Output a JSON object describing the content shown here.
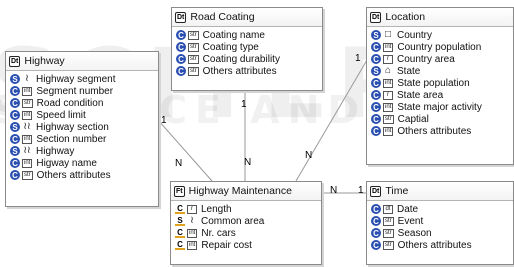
{
  "watermark": {
    "line1": "SCITEPRESS",
    "line2": "SCIENCE AND TECHNOLOGY PUBLICATIONS"
  },
  "colors": {
    "circle_blue": "#2a4fb1",
    "measure_underline": "#e0a21a",
    "border": "#8a8a8a"
  },
  "cards": {
    "road_coating": {
      "badge": "Dt",
      "title": "Road Coating",
      "rows": [
        {
          "kind": "C",
          "dt": "str",
          "label": "Coating name"
        },
        {
          "kind": "C",
          "dt": "str",
          "label": "Coating type"
        },
        {
          "kind": "C",
          "dt": "str",
          "label": "Coating durability"
        },
        {
          "kind": "C",
          "dt": "str",
          "label": "Others attributes"
        }
      ]
    },
    "location": {
      "badge": "Dt",
      "title": "Location",
      "rows": [
        {
          "kind": "S",
          "dt": "□",
          "label": "Country"
        },
        {
          "kind": "C",
          "dt": "int",
          "label": "Country population"
        },
        {
          "kind": "C",
          "dt": "r",
          "label": "Country area"
        },
        {
          "kind": "S",
          "dt": "⌂",
          "label": "State"
        },
        {
          "kind": "C",
          "dt": "int",
          "label": "State population"
        },
        {
          "kind": "C",
          "dt": "r",
          "label": "State area"
        },
        {
          "kind": "C",
          "dt": "int",
          "label": "State major activity"
        },
        {
          "kind": "C",
          "dt": "str",
          "label": "Captial"
        },
        {
          "kind": "C",
          "dt": "int",
          "label": "Others attributes"
        }
      ]
    },
    "highway": {
      "badge": "Dt",
      "title": "Highway",
      "rows": [
        {
          "kind": "S",
          "dt": "≀",
          "label": "Highway segment"
        },
        {
          "kind": "C",
          "dt": "int",
          "label": "Segment number"
        },
        {
          "kind": "C",
          "dt": "str",
          "label": "Road condition"
        },
        {
          "kind": "C",
          "dt": "int",
          "label": "Speed limit"
        },
        {
          "kind": "S",
          "dt": "≀≀",
          "label": "Highway section"
        },
        {
          "kind": "C",
          "dt": "int",
          "label": "Section number"
        },
        {
          "kind": "S",
          "dt": "≀≀",
          "label": "Highway"
        },
        {
          "kind": "C",
          "dt": "int",
          "label": "Higway name"
        },
        {
          "kind": "C",
          "dt": "str",
          "label": "Others attributes"
        }
      ]
    },
    "maintenance": {
      "badge": "Ft",
      "title": "Highway Maintenance",
      "rows": [
        {
          "kind": "C",
          "dt": "r",
          "label": "Length"
        },
        {
          "kind": "S",
          "dt": "≀",
          "label": "Common area"
        },
        {
          "kind": "C",
          "dt": "int",
          "label": "Nr. cars"
        },
        {
          "kind": "C",
          "dt": "int",
          "label": "Repair cost"
        }
      ]
    },
    "time": {
      "badge": "Dt",
      "title": "Time",
      "rows": [
        {
          "kind": "C",
          "dt": "dt",
          "label": "Date"
        },
        {
          "kind": "C",
          "dt": "str",
          "label": "Event"
        },
        {
          "kind": "C",
          "dt": "str",
          "label": "Season"
        },
        {
          "kind": "C",
          "dt": "str",
          "label": "Others attributes"
        }
      ]
    }
  },
  "multiplicities": {
    "highway_one": "1",
    "highway_many": "N",
    "road_one": "1",
    "road_many": "N",
    "location_one": "1",
    "location_many": "N",
    "time_many": "N",
    "time_one": "1"
  }
}
